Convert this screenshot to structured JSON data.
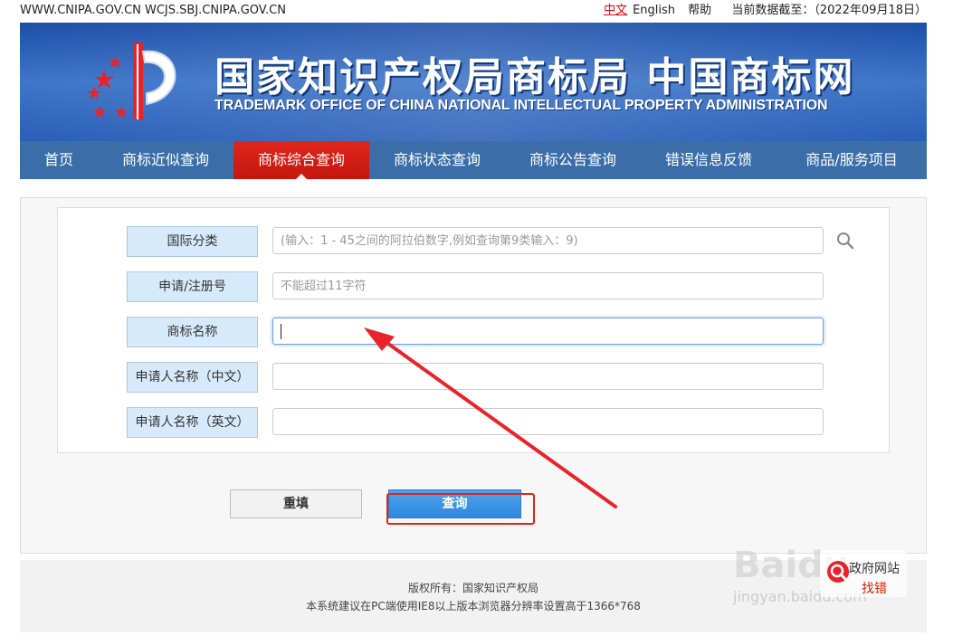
{
  "topbar": {
    "domains": "WWW.CNIPA.GOV.CN WCJS.SBJ.CNIPA.GOV.CN",
    "lang_zh": "中文",
    "lang_en": "English",
    "help": "帮助",
    "data_date": "当前数据截至：（2022年09月18日）"
  },
  "banner": {
    "title": "国家知识产权局商标局 中国商标网",
    "subtitle": "TRADEMARK OFFICE OF CHINA NATIONAL INTELLECTUAL PROPERTY ADMINISTRATION"
  },
  "nav": {
    "items": [
      {
        "label": "首页"
      },
      {
        "label": "商标近似查询"
      },
      {
        "label": "商标综合查询",
        "active": true
      },
      {
        "label": "商标状态查询"
      },
      {
        "label": "商标公告查询"
      },
      {
        "label": "错误信息反馈"
      },
      {
        "label": "商品/服务项目"
      }
    ]
  },
  "form": {
    "fields": [
      {
        "label": "国际分类",
        "placeholder": "(输入：1 - 45之间的阿拉伯数字,例如查询第9类输入：9)",
        "value": ""
      },
      {
        "label": "申请/注册号",
        "placeholder": "不能超过11字符",
        "value": ""
      },
      {
        "label": "商标名称",
        "placeholder": "",
        "value": ""
      },
      {
        "label": "申请人名称（中文）",
        "placeholder": "",
        "value": ""
      },
      {
        "label": "申请人名称（英文）",
        "placeholder": "",
        "value": ""
      }
    ],
    "reset_label": "重填",
    "query_label": "查询"
  },
  "footer": {
    "copyright": "版权所有：国家知识产权局",
    "browser_note": "本系统建议在PC端使用IE8以上版本浏览器分辨率设置高于1366*768"
  },
  "watermark": {
    "brand": "Baidu",
    "site": "jingyan.baidu.com",
    "badge_line1": "政府网站",
    "badge_line2": "找错"
  },
  "colors": {
    "nav_bg": "#3b6ea8",
    "nav_active": "#e0251b",
    "label_bg": "#d7eafb",
    "query_btn": "#3a93e6",
    "annotation_red": "#e2231a"
  }
}
